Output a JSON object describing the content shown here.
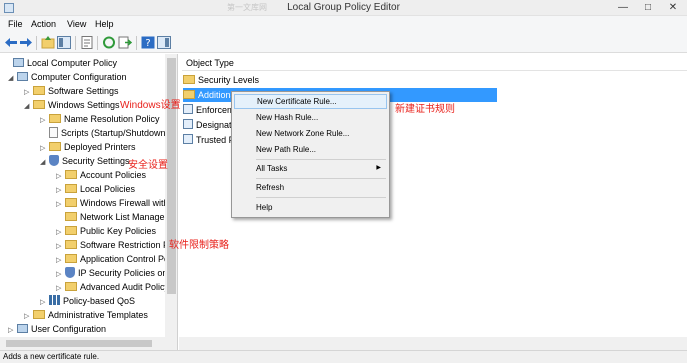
{
  "window": {
    "title": "Local Group Policy Editor",
    "watermark": "第一文库网",
    "controls": {
      "minimize": "—",
      "maximize": "□",
      "close": "✕"
    }
  },
  "menu": [
    "File",
    "Action",
    "View",
    "Help"
  ],
  "toolbar": {
    "icons": [
      "back-arrow-icon",
      "forward-arrow-icon",
      "up-folder-icon",
      "show-hide-tree-icon",
      "properties-icon",
      "refresh-icon",
      "export-list-icon",
      "help-icon",
      "show-hide-action-pane-icon"
    ]
  },
  "tree": [
    {
      "label": "Local Computer Policy",
      "exp": "",
      "icon": "comp"
    },
    {
      "label": "Computer Configuration",
      "exp": "◢",
      "icon": "comp"
    },
    {
      "label": "Software Settings",
      "exp": "▷",
      "icon": "folder"
    },
    {
      "label": "Windows Settings",
      "exp": "◢",
      "icon": "folder"
    },
    {
      "label": "Name Resolution Policy",
      "exp": "▷",
      "icon": "folder"
    },
    {
      "label": "Scripts (Startup/Shutdown",
      "exp": "",
      "icon": "page"
    },
    {
      "label": "Deployed Printers",
      "exp": "▷",
      "icon": "folder"
    },
    {
      "label": "Security Settings",
      "exp": "◢",
      "icon": "shield"
    },
    {
      "label": "Account Policies",
      "exp": "▷",
      "icon": "folder"
    },
    {
      "label": "Local Policies",
      "exp": "▷",
      "icon": "folder"
    },
    {
      "label": "Windows Firewall with /",
      "exp": "▷",
      "icon": "folder"
    },
    {
      "label": "Network List Manager",
      "exp": "",
      "icon": "folder"
    },
    {
      "label": "Public Key Policies",
      "exp": "▷",
      "icon": "folder"
    },
    {
      "label": "Software Restriction Po",
      "exp": "▷",
      "icon": "folder"
    },
    {
      "label": "Application Control Pol",
      "exp": "▷",
      "icon": "folder"
    },
    {
      "label": "IP Security Policies on I",
      "exp": "▷",
      "icon": "shield"
    },
    {
      "label": "Advanced Audit Policy",
      "exp": "▷",
      "icon": "folder"
    },
    {
      "label": "Policy-based QoS",
      "exp": "▷",
      "icon": "bars"
    },
    {
      "label": "Administrative Templates",
      "exp": "▷",
      "icon": "folder"
    },
    {
      "label": "User Configuration",
      "exp": "▷",
      "icon": "comp"
    }
  ],
  "annotations": {
    "windows_settings": "Windows设置",
    "security_settings": "安全设置",
    "software_restriction": "软件限制策略",
    "new_cert_rule": "新建证书规则"
  },
  "list": {
    "header": "Object Type",
    "rows": [
      {
        "label": "Security Levels",
        "selected": false,
        "icon": "folder"
      },
      {
        "label": "Additional Rules",
        "selected": true,
        "icon": "folder"
      },
      {
        "label": "Enforcement",
        "selected": false,
        "icon": "doc"
      },
      {
        "label": "Designated File Types",
        "selected": false,
        "icon": "doc"
      },
      {
        "label": "Trusted Publishers",
        "selected": false,
        "icon": "doc"
      }
    ]
  },
  "context_menu": {
    "items": [
      "New Certificate Rule...",
      "New Hash Rule...",
      "New Network Zone Rule...",
      "New Path Rule...",
      "All Tasks",
      "Refresh",
      "Help"
    ],
    "submenu_arrow": "▶"
  },
  "status": "Adds a new certificate rule."
}
